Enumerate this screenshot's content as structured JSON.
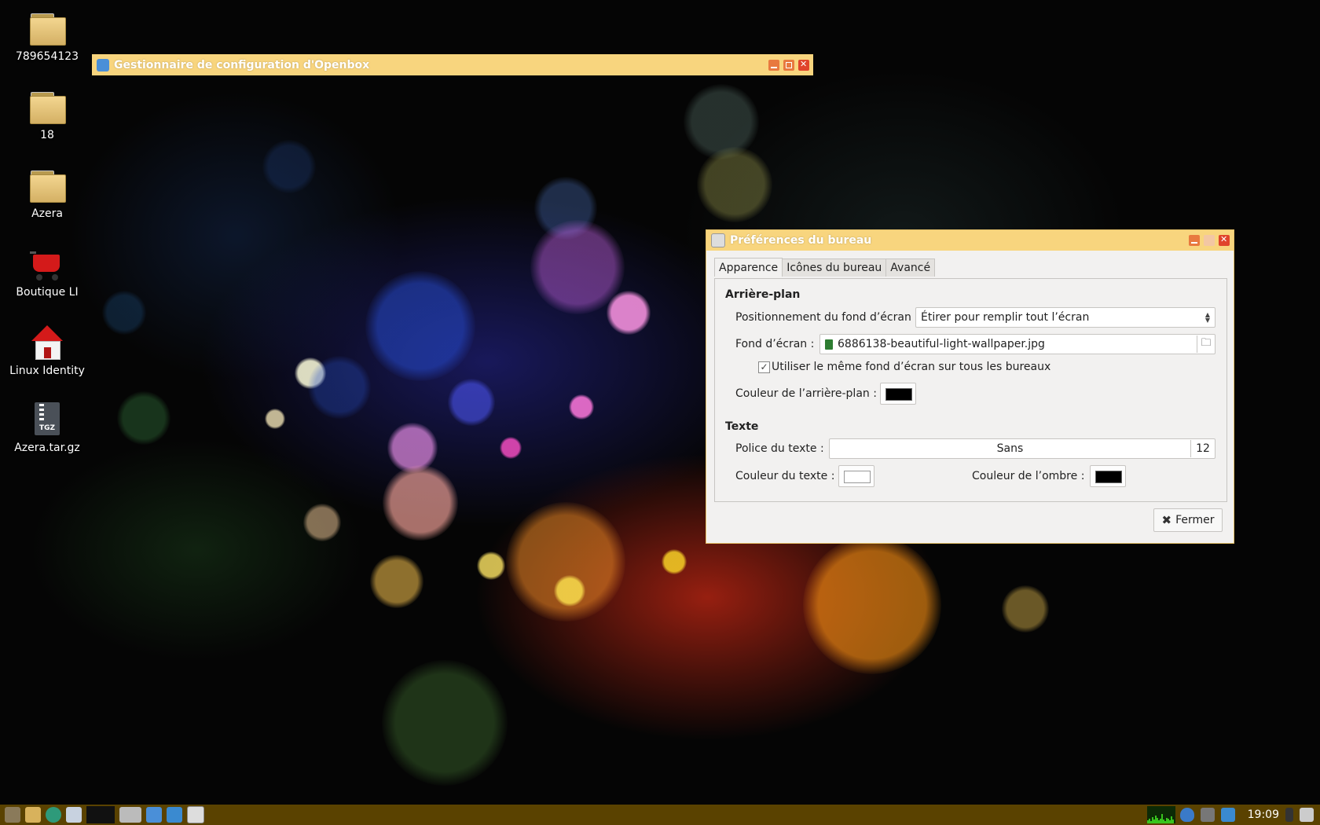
{
  "desktop": {
    "icons": [
      {
        "label": "789654123",
        "icon": "folder-icon"
      },
      {
        "label": "18",
        "icon": "folder-icon"
      },
      {
        "label": "Azera",
        "icon": "folder-icon"
      },
      {
        "label": "Boutique LI",
        "icon": "shopping-cart-icon"
      },
      {
        "label": "Linux Identity",
        "icon": "home-icon"
      },
      {
        "label": "Azera.tar.gz",
        "icon": "archive-tgz-icon",
        "badge": "TGZ"
      }
    ]
  },
  "openbox_window": {
    "title": "Gestionnaire de configuration d'Openbox"
  },
  "prefs_window": {
    "title": "Préférences du bureau",
    "tabs": [
      {
        "label": "Apparence",
        "active": true
      },
      {
        "label": "Icônes du bureau",
        "active": false
      },
      {
        "label": "Avancé",
        "active": false
      }
    ],
    "background": {
      "heading": "Arrière-plan",
      "mode_label": "Positionnement du fond d’écran :",
      "mode_value": "Étirer pour remplir tout l’écran",
      "wallpaper_label": "Fond d’écran :",
      "wallpaper_value": "6886138-beautiful-light-wallpaper.jpg",
      "same_for_all_label": "Utiliser le même fond d’écran sur tous les bureaux",
      "same_for_all_checked": true,
      "color_label": "Couleur de l’arrière-plan :",
      "color_value": "#000000"
    },
    "text": {
      "heading": "Texte",
      "font_label": "Police du texte :",
      "font_name": "Sans",
      "font_size": "12",
      "text_color_label": "Couleur du texte :",
      "text_color_value": "#ffffff",
      "shadow_color_label": "Couleur de l’ombre :",
      "shadow_color_value": "#000000"
    },
    "close_label": "Fermer"
  },
  "taskbar": {
    "clock": "19:09"
  },
  "colors": {
    "titlebar": "#f8d57e",
    "taskbar": "#5a4200"
  }
}
